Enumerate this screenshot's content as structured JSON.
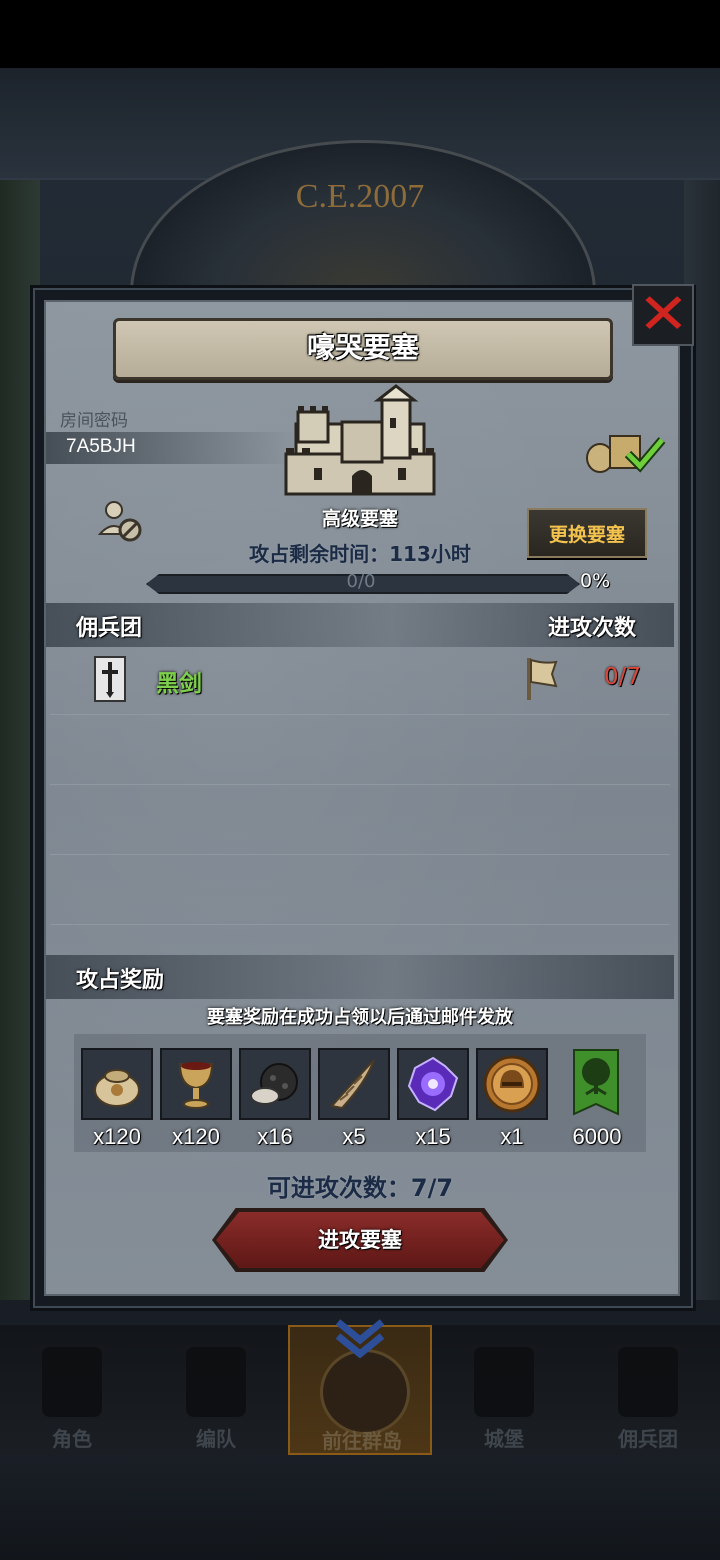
{
  "background": {
    "year_text": "C.E.2007"
  },
  "dialog": {
    "title": "嚎哭要塞",
    "close_icon": "close-icon",
    "room": {
      "label": "房间密码",
      "code": "7A5BJH"
    },
    "fortress": {
      "type": "高级要塞",
      "time_left_label": "攻占剩余时间：",
      "time_left_value": "113小时",
      "change_button": "更换要塞"
    },
    "progress": {
      "text": "0/0",
      "percent_text": "0%",
      "fraction": 0
    },
    "mercenary_section": {
      "left_header": "佣兵团",
      "right_header": "进攻次数",
      "rows": [
        {
          "name": "黑剑",
          "attacks": "0/7"
        }
      ]
    },
    "rewards": {
      "header": "攻占奖励",
      "note": "要塞奖励在成功占领以后通过邮件发放",
      "items": [
        {
          "icon": "coin-sack-icon",
          "qty": "x120"
        },
        {
          "icon": "goblet-icon",
          "qty": "x120"
        },
        {
          "icon": "ore-icon",
          "qty": "x16"
        },
        {
          "icon": "horn-icon",
          "qty": "x5"
        },
        {
          "icon": "purple-crystal-icon",
          "qty": "x15"
        },
        {
          "icon": "helmet-medal-icon",
          "qty": "x1"
        },
        {
          "icon": "tree-banner-icon",
          "qty": "6000"
        }
      ]
    },
    "remaining_attacks": "可进攻次数：7/7",
    "attack_button": "进攻要塞"
  },
  "bottom_nav": {
    "items": [
      {
        "label": "角色",
        "icon": "character-icon"
      },
      {
        "label": "编队",
        "icon": "formation-icon"
      },
      {
        "label": "前往群岛",
        "icon": "islands-icon",
        "active": true
      },
      {
        "label": "城堡",
        "icon": "castle-icon"
      },
      {
        "label": "佣兵团",
        "icon": "mercenary-icon"
      }
    ]
  },
  "colors": {
    "accent_gold": "#f3c34e",
    "guild_green": "#7ed04c",
    "count_red": "#d9493b",
    "close_red": "#d0241f"
  }
}
